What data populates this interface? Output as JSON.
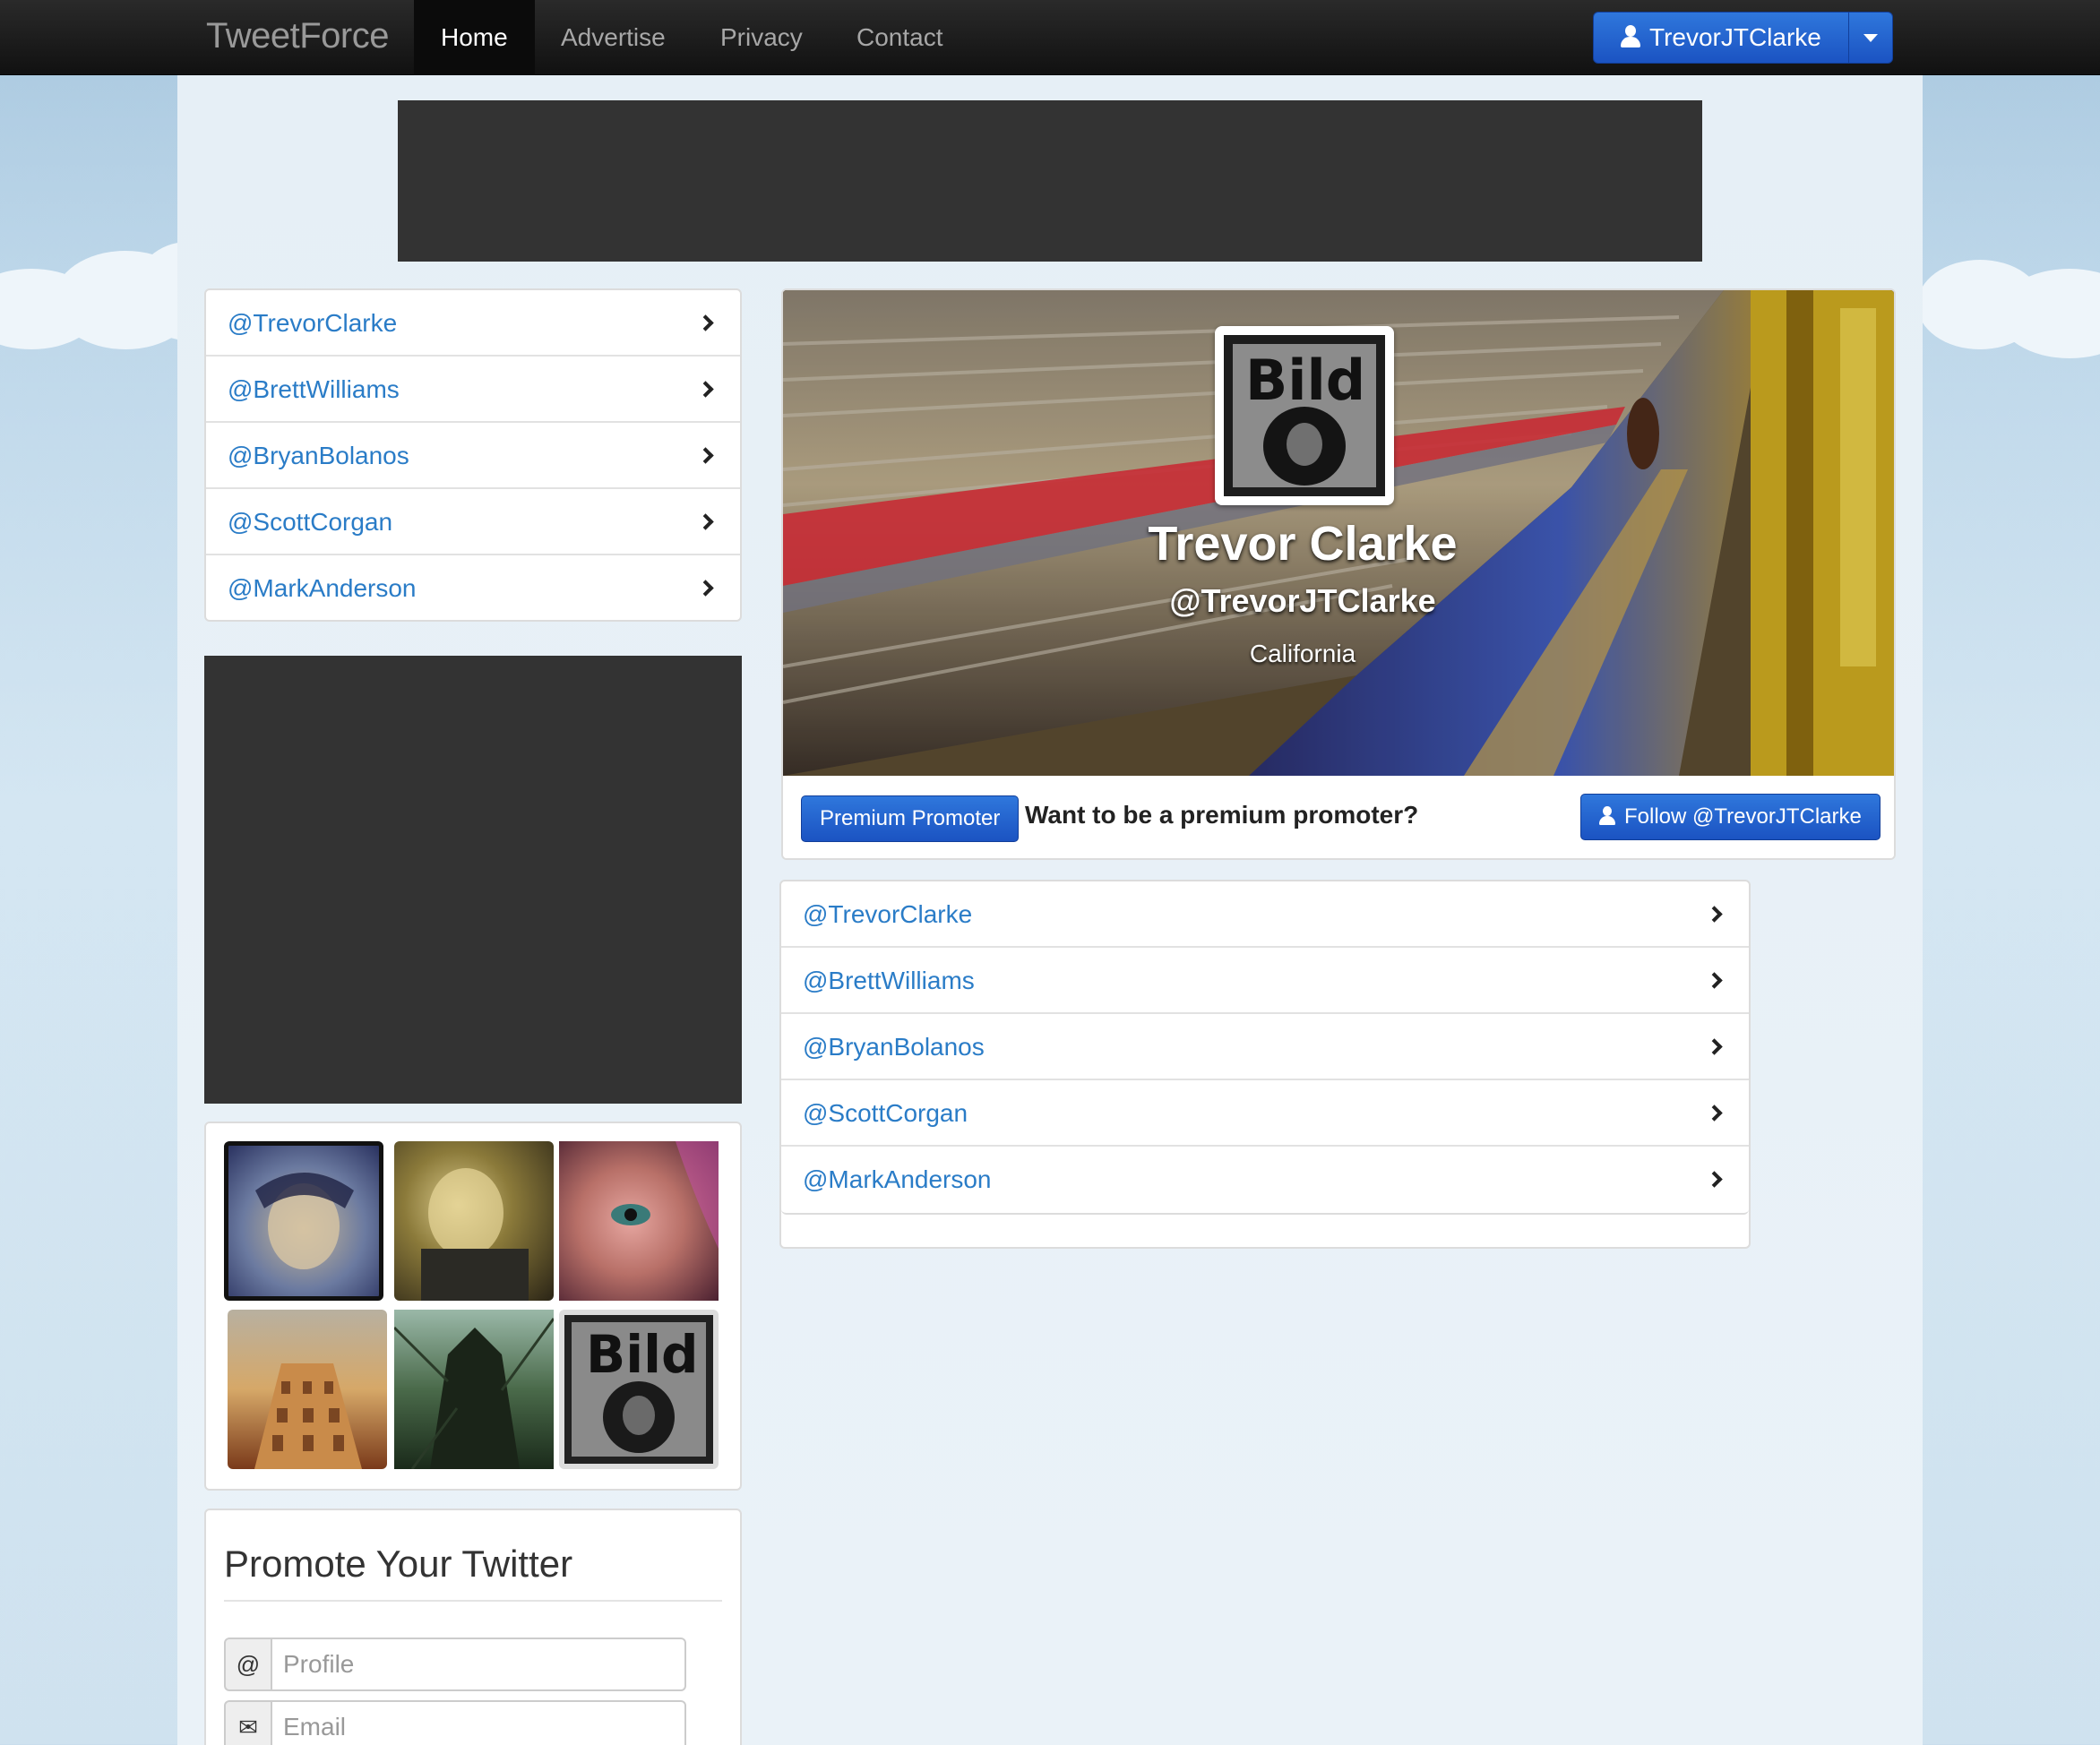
{
  "navbar": {
    "brand": "TweetForce",
    "items": [
      {
        "label": "Home",
        "active": true
      },
      {
        "label": "Advertise",
        "active": false
      },
      {
        "label": "Privacy",
        "active": false
      },
      {
        "label": "Contact",
        "active": false
      }
    ],
    "user_button_label": "TrevorJTClarke"
  },
  "sidebar": {
    "users": [
      "@TrevorClarke",
      "@BrettWilliams",
      "@BryanBolanos",
      "@ScottCorgan",
      "@MarkAnderson"
    ]
  },
  "photos": [
    "photo-1",
    "photo-2",
    "photo-3",
    "photo-4",
    "photo-5",
    "photo-6"
  ],
  "promote": {
    "title": "Promote Your Twitter",
    "profile_addon": "@",
    "profile_placeholder": "Profile",
    "email_placeholder": "Email"
  },
  "profile": {
    "name": "Trevor Clarke",
    "handle": "@TrevorJTClarke",
    "location": "California",
    "premium_button": "Premium Promoter",
    "premium_text": "Want to be a premium promoter?",
    "follow_button": "Follow @TrevorJTClarke"
  },
  "main_list": {
    "users": [
      "@TrevorClarke",
      "@BrettWilliams",
      "@BryanBolanos",
      "@ScottCorgan",
      "@MarkAnderson"
    ]
  },
  "colors": {
    "accent": "#2a7cc7",
    "button_blue": "#1b53c2",
    "navbar": "#111111"
  }
}
